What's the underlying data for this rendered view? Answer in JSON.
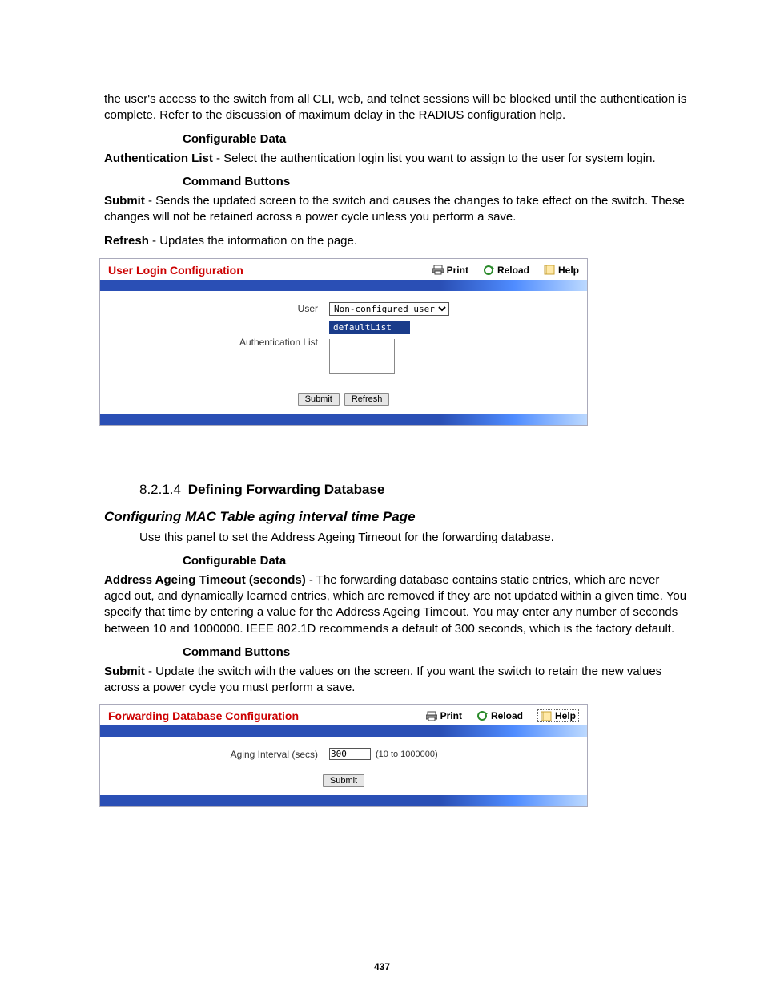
{
  "intro_paragraph": "the user's access to the switch from all CLI, web, and telnet sessions will be blocked until the authentication is complete. Refer to the discussion of maximum delay in the RADIUS configuration help.",
  "configurable_data_label": "Configurable Data",
  "auth_list_bold": "Authentication List",
  "auth_list_desc": " - Select the authentication login list you want to assign to the user for system login.",
  "command_buttons_label": "Command Buttons",
  "submit_bold": "Submit",
  "submit_desc": " - Sends the updated screen to the switch and causes the changes to take effect on the switch. These changes will not be retained across a power cycle unless you perform a save.",
  "refresh_bold": "Refresh",
  "refresh_desc": " - Updates the information on the page.",
  "panel1": {
    "title": "User Login Configuration",
    "print": "Print",
    "reload": "Reload",
    "help": "Help",
    "user_label": "User",
    "user_value": "Non-configured user",
    "auth_label": "Authentication List",
    "auth_value": "defaultList",
    "submit": "Submit",
    "refresh": "Refresh"
  },
  "sec_num": "8.2.1.4",
  "sec_title": "Defining Forwarding Database",
  "sub_title": "Configuring MAC Table aging interval time Page",
  "sub_intro": "Use this panel to set the Address Ageing Timeout for the forwarding database.",
  "addr_bold": "Address Ageing Timeout (seconds)",
  "addr_desc": " - The forwarding database contains static entries, which are never aged out, and dynamically learned entries, which are removed if they are not updated within a given time. You specify that time by entering a value for the Address Ageing Timeout. You may enter any number of seconds between 10 and 1000000. IEEE 802.1D recommends a default of 300 seconds, which is the factory default.",
  "submit2_desc": " - Update the switch with the values on the screen. If you want the switch to retain the new values across a power cycle you must perform a save.",
  "panel2": {
    "title": "Forwarding Database Configuration",
    "print": "Print",
    "reload": "Reload",
    "help": "Help",
    "aging_label": "Aging Interval (secs)",
    "aging_value": "300",
    "range": "(10 to 1000000)",
    "submit": "Submit"
  },
  "page_number": "437"
}
